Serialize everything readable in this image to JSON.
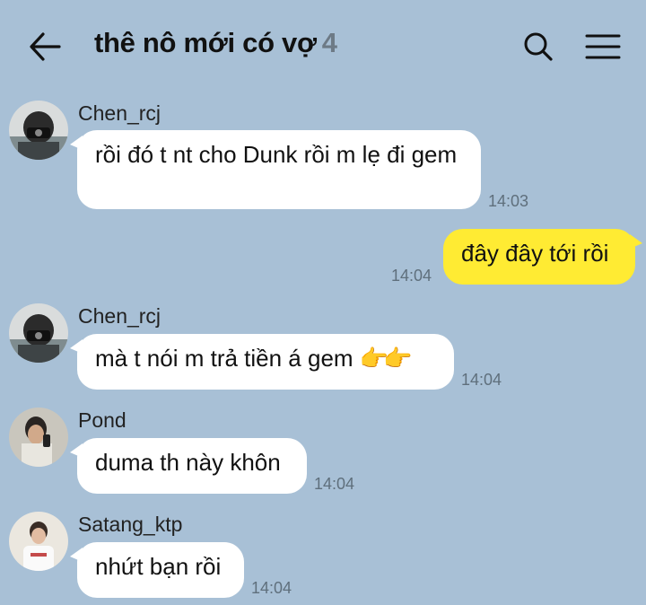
{
  "header": {
    "title": "thê nô mới có vợ",
    "member_count": "4"
  },
  "messages": [
    {
      "sender": "Chen_rcj",
      "text": "rồi đó t nt cho Dunk rồi m lẹ đi gem",
      "time": "14:03",
      "direction": "incoming"
    },
    {
      "sender": "",
      "text": "đây đây tới rồi",
      "time": "14:04",
      "direction": "outgoing"
    },
    {
      "sender": "Chen_rcj",
      "text": "mà t nói m trả tiền á gem",
      "emoji": "👉👉",
      "time": "14:04",
      "direction": "incoming"
    },
    {
      "sender": "Pond",
      "text": "duma th này khôn",
      "time": "14:04",
      "direction": "incoming"
    },
    {
      "sender": "Satang_ktp",
      "text": "nhứt bạn rồi",
      "time": "14:04",
      "direction": "incoming"
    }
  ],
  "colors": {
    "background": "#a8c0d6",
    "incoming_bubble": "#ffffff",
    "outgoing_bubble": "#ffeb33",
    "timestamp": "#5f6f7c"
  },
  "icons": {
    "back": "arrow-left-icon",
    "search": "search-icon",
    "menu": "hamburger-menu-icon"
  }
}
